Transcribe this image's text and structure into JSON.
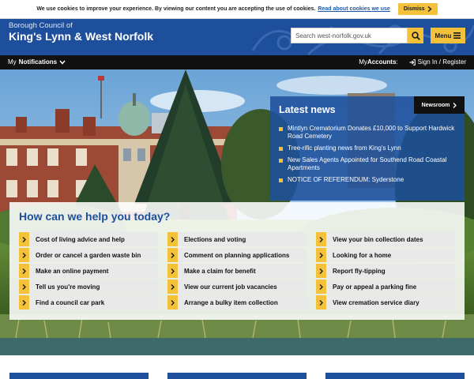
{
  "cookie": {
    "text": "We use cookies to improve your experience. By viewing our content you are accepting the use of cookies.",
    "link": "Read about cookies we use",
    "dismiss": "Dismiss"
  },
  "header": {
    "brand_small": "Borough Council of",
    "brand_big": "King's Lynn & West Norfolk",
    "search_placeholder": "Search west-norfolk.gov.uk",
    "menu_label": "Menu"
  },
  "nav": {
    "notifications_prefix": "My",
    "notifications_bold": "Notifications",
    "accounts_prefix": "My",
    "accounts_bold": "Accounts",
    "signin": "Sign In / Register"
  },
  "news": {
    "title": "Latest news",
    "newsroom": "Newsroom",
    "items": [
      "Mintlyn Crematorium Donates £10,000 to Support Hardwick Road Cemetery",
      "Tree-rific planting news from King's Lynn",
      "New Sales Agents Appointed for Southend Road Coastal Apartments",
      "NOTICE OF REFERENDUM: Syderstone"
    ]
  },
  "help": {
    "title": "How can we help you today?",
    "col1": [
      "Cost of living advice and help",
      "Order or cancel a garden waste bin",
      "Make an online payment",
      "Tell us you're moving",
      "Find a council car park"
    ],
    "col2": [
      "Elections and voting",
      "Comment on planning applications",
      "Make a claim for benefit",
      "View our current job vacancies",
      "Arrange a bulky item collection"
    ],
    "col3": [
      "View your bin collection dates",
      "Looking for a home",
      "Report fly-tipping",
      "Pay or appeal a parking fine",
      "View cremation service diary"
    ]
  },
  "colors": {
    "brand_blue": "#1d4f9c",
    "accent_yellow": "#f3c13a",
    "nav_black": "#111111"
  }
}
